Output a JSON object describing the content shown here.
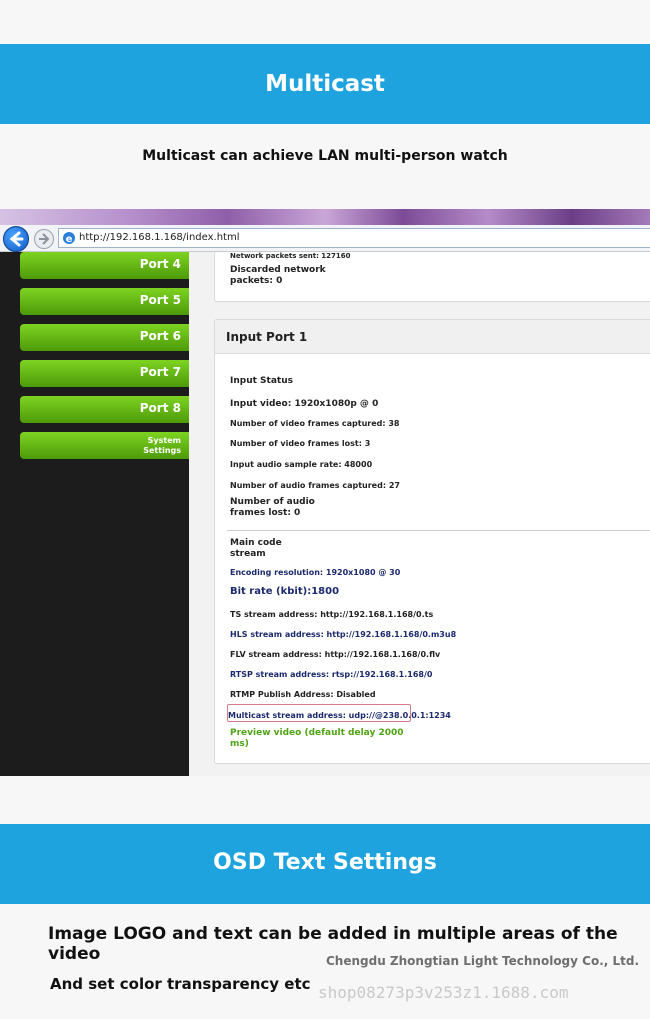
{
  "banner1": {
    "title": "Multicast"
  },
  "subtitle1": "Multicast can achieve LAN multi-person watch",
  "browser": {
    "url": "http://192.168.1.168/index.html"
  },
  "sidebar": {
    "items": [
      {
        "label": "Port 4"
      },
      {
        "label": "Port 5"
      },
      {
        "label": "Port 6"
      },
      {
        "label": "Port 7"
      },
      {
        "label": "Port 8"
      },
      {
        "label": "System\nSettings"
      }
    ]
  },
  "panel1": {
    "packets_sent": "Network packets sent: 127160",
    "discarded": "Discarded network\npackets: 0"
  },
  "panel2": {
    "title": "Input Port 1",
    "input_status": "Input Status",
    "input_video": "Input video: 1920x1080p @ 0",
    "frames_captured": "Number of video frames captured: 38",
    "frames_lost": "Number of video frames lost: 3",
    "audio_rate": "Input audio sample rate: 48000",
    "audio_frames_captured": "Number of audio frames captured: 27",
    "audio_frames_lost": "Number of audio\nframes lost: 0",
    "main_code": "Main code\nstream",
    "encoding_resolution": "Encoding resolution: 1920x1080 @ 30",
    "bit_rate": "Bit rate (kbit):1800",
    "ts_address": "TS stream address: http://192.168.1.168/0.ts",
    "hls_address": "HLS stream address: http://192.168.1.168/0.m3u8",
    "flv_address": "FLV stream address: http://192.168.1.168/0.flv",
    "rtsp_address": "RTSP stream address: rtsp://192.168.1.168/0",
    "rtmp_publish": "RTMP Publish Address: Disabled",
    "multicast_address": "Multicast stream address: udp://@238.0.0.1:1234",
    "preview_link": "Preview video (default delay 2000\nms)"
  },
  "banner2": {
    "title": "OSD Text Settings"
  },
  "subtitle2": "Image LOGO and text can be added in multiple areas of the video",
  "company": "Chengdu Zhongtian Light Technology Co., Ltd.",
  "subtitle3": "And set color transparency etc",
  "watermark": "shop08273p3v253z1.1688.com",
  "colors": {
    "banner": "#1ea3de",
    "port_button": "#5fb515",
    "sidebar": "#1c1c1c"
  }
}
